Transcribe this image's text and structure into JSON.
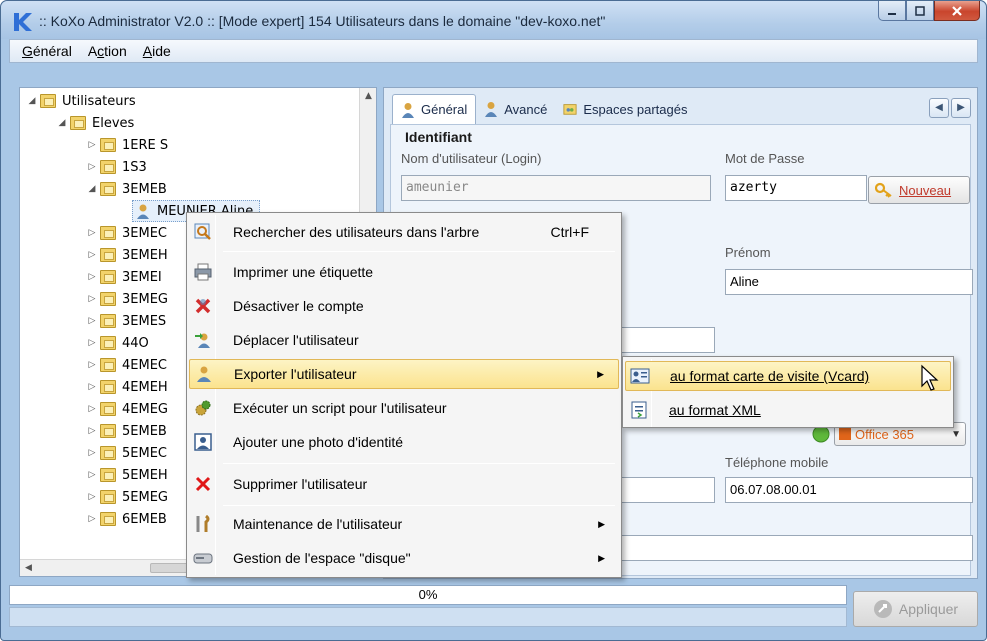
{
  "window": {
    "title": ":: KoXo Administrator V2.0 :: [Mode expert] 154 Utilisateurs dans le domaine \"dev-koxo.net\""
  },
  "menubar": {
    "items": [
      {
        "label_pre": "",
        "label_u": "G",
        "label_post": "énéral"
      },
      {
        "label_pre": "A",
        "label_u": "c",
        "label_post": "tion"
      },
      {
        "label_pre": "",
        "label_u": "A",
        "label_post": "ide"
      }
    ]
  },
  "tree": {
    "root": "Utilisateurs",
    "group": "Eleves",
    "items": [
      "1ERE S",
      "1S3",
      "3EMEB",
      "MEUNIER Aline",
      "3EMEC",
      "3EMEH",
      "3EMEI",
      "3EMEG",
      "3EMES",
      "44O",
      "4EMEC",
      "4EMEH",
      "4EMEG",
      "5EMEB",
      "5EMEC",
      "5EMEH",
      "5EMEG",
      "6EMEB"
    ]
  },
  "tabs": {
    "general": "Général",
    "avance": "Avancé",
    "espaces": "Espaces partagés"
  },
  "form": {
    "section_identifiant": "Identifiant",
    "login_label": "Nom d'utilisateur (Login)",
    "login_value": "ameunier",
    "password_label": "Mot de Passe",
    "password_value": "azerty",
    "new_button_u": "N",
    "new_button_rest": "ouveau",
    "prenom_label": "Prénom",
    "prenom_value": "Aline",
    "mobile_label": "Téléphone mobile",
    "mobile_value": "06.07.08.00.01",
    "office_label": "Office 365"
  },
  "context_menu": {
    "items": [
      {
        "label": "Rechercher des utilisateurs dans l'arbre",
        "shortcut": "Ctrl+F",
        "icon": "search-icon"
      },
      {
        "label": "Imprimer une étiquette",
        "icon": "printer-icon"
      },
      {
        "label": "Désactiver le compte",
        "icon": "disable-x-icon"
      },
      {
        "label": "Déplacer l'utilisateur",
        "icon": "move-user-icon"
      },
      {
        "label": "Exporter l'utilisateur",
        "icon": "export-user-icon",
        "submenu": true
      },
      {
        "label": "Exécuter un script pour l'utilisateur",
        "icon": "script-gear-icon"
      },
      {
        "label": "Ajouter une photo d'identité",
        "icon": "photo-id-icon"
      },
      {
        "label": "Supprimer l'utilisateur",
        "icon": "delete-x-icon"
      },
      {
        "label": "Maintenance de l'utilisateur",
        "icon": "tools-icon",
        "submenu": true
      },
      {
        "label": "Gestion de l'espace \"disque\"",
        "icon": "disk-icon",
        "submenu": true
      }
    ]
  },
  "submenu": {
    "items": [
      {
        "label": "au format carte de visite (Vcard)",
        "icon": "vcard-icon"
      },
      {
        "label": "au format XML",
        "icon": "xml-file-icon"
      }
    ]
  },
  "status": {
    "progress_text": "0%",
    "progress_value": 0,
    "apply_label": "Appliquer"
  },
  "colors": {
    "highlight": "#fbe38e",
    "accent": "#c0392b"
  }
}
